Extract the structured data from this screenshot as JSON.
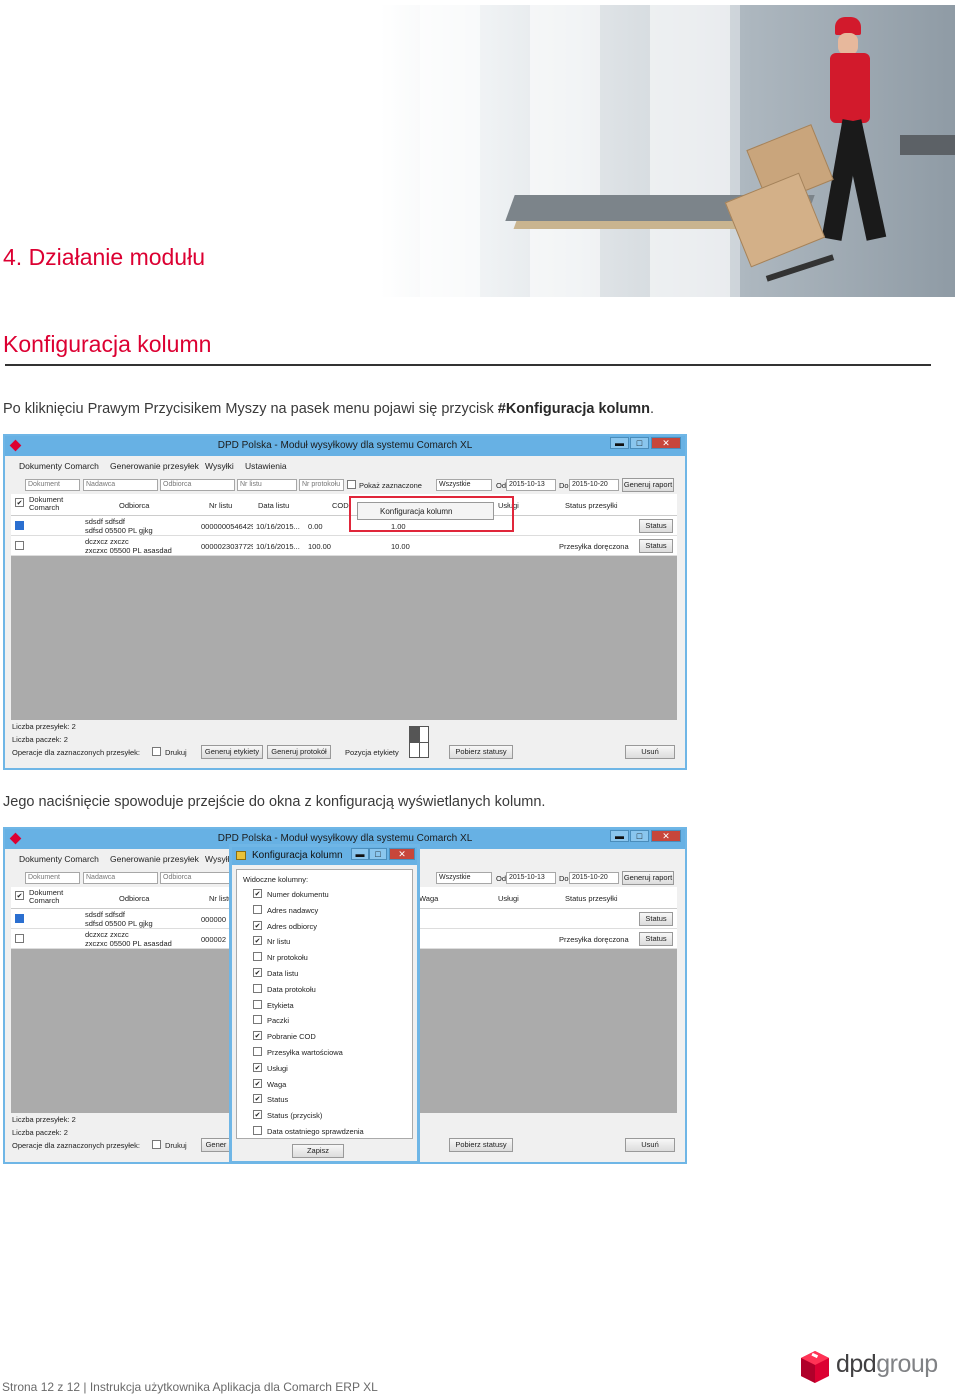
{
  "section_number_title": "4. Działanie modułu",
  "subsection_title": "Konfiguracja kolumn",
  "paragraph1": {
    "text": "Po kliknięciu Prawym Przycisikem Myszy na pasek menu pojawi się przycisk ",
    "highlight": "#Konfiguracja kolumn",
    "end": "."
  },
  "paragraph2": "Jego naciśnięcie spowoduje przejście do okna z konfiguracją wyświetlanych kolumn.",
  "app": {
    "title": "DPD Polska - Moduł wysyłkowy dla systemu Comarch XL",
    "window_buttons": [
      "▬",
      "□",
      "✕"
    ],
    "menu": [
      "Dokumenty Comarch",
      "Generowanie przesyłek",
      "Wysyłki",
      "Ustawienia"
    ],
    "filters": {
      "dokument": "Dokument",
      "nadawca": "Nadawca",
      "odbiorca": "Odbiorca",
      "nr_listu": "Nr listu",
      "nr_protokolu": "Nr protokołu",
      "pokaz_zaznaczone": "Pokaż zaznaczone",
      "status_select": "Wszystkie",
      "od_label": "Od",
      "od_value": "2015-10-13",
      "do_label": "Do",
      "do_value": "2015-10-20",
      "generuj_raport": "Generuj raport"
    },
    "columns": [
      "Dokument Comarch",
      "Odbiorca",
      "Nr listu",
      "Data listu",
      "COD",
      "Waga",
      "Usługi",
      "Status przesyłki"
    ],
    "rows": [
      {
        "odbiorca1": "sdsdf sdfsdf",
        "odbiorca2": "sdfsd 05500 PL gjkg",
        "nr_listu": "00000005464297",
        "nr_listu_short": "000000",
        "data": "10/16/2015...",
        "cod": "0.00",
        "waga": "1.00",
        "status": "",
        "status_btn": "Status"
      },
      {
        "odbiorca1": "dczxcz zxczc",
        "odbiorca2": "zxczxc 05500 PL asasdad",
        "nr_listu": "00000230377293",
        "nr_listu_short": "000002",
        "data": "10/16/2015...",
        "cod": "100.00",
        "waga": "10.00",
        "status": "Przesyłka doręczona",
        "status_btn": "Status"
      }
    ],
    "context_menu_item": "Konfiguracja kolumn",
    "bottom": {
      "liczba_przesylek": "Liczba przesyłek: 2",
      "liczba_paczek": "Liczba paczek: 2",
      "operacje": "Operacje dla zaznaczonych przesyłek:",
      "drukuj": "Drukuj",
      "generuj_etykiety": "Generuj etykiety",
      "generuj_etykiety_short": "Gener",
      "generuj_protokol": "Generuj protokół",
      "pozycja_etykiety": "Pozycja etykiety",
      "pobierz_statusy": "Pobierz statusy",
      "usun": "Usuń"
    }
  },
  "dialog": {
    "title": "Konfiguracja kolumn",
    "group_label": "Widoczne kolumny:",
    "items": [
      {
        "label": "Numer dokumentu",
        "checked": true
      },
      {
        "label": "Adres nadawcy",
        "checked": false
      },
      {
        "label": "Adres odbiorcy",
        "checked": true
      },
      {
        "label": "Nr listu",
        "checked": true
      },
      {
        "label": "Nr protokołu",
        "checked": false
      },
      {
        "label": "Data listu",
        "checked": true
      },
      {
        "label": "Data protokołu",
        "checked": false
      },
      {
        "label": "Etykieta",
        "checked": false
      },
      {
        "label": "Paczki",
        "checked": false
      },
      {
        "label": "Pobranie COD",
        "checked": true
      },
      {
        "label": "Przesyłka wartościowa",
        "checked": false
      },
      {
        "label": "Usługi",
        "checked": true
      },
      {
        "label": "Waga",
        "checked": true
      },
      {
        "label": "Status",
        "checked": true
      },
      {
        "label": "Status (przycisk)",
        "checked": true
      },
      {
        "label": "Data ostatniego sprawdzenia",
        "checked": false
      }
    ],
    "save": "Zapisz",
    "partial_headers": [
      "Waga",
      "Usługi",
      "Status przesyłki"
    ]
  },
  "footer": "Strona 12 z 12 | Instrukcja użytkownika Aplikacja dla Comarch ERP XL",
  "brand": {
    "part1": "dpd",
    "part2": "group",
    "red": "#dc0032",
    "grey": "#808285"
  }
}
